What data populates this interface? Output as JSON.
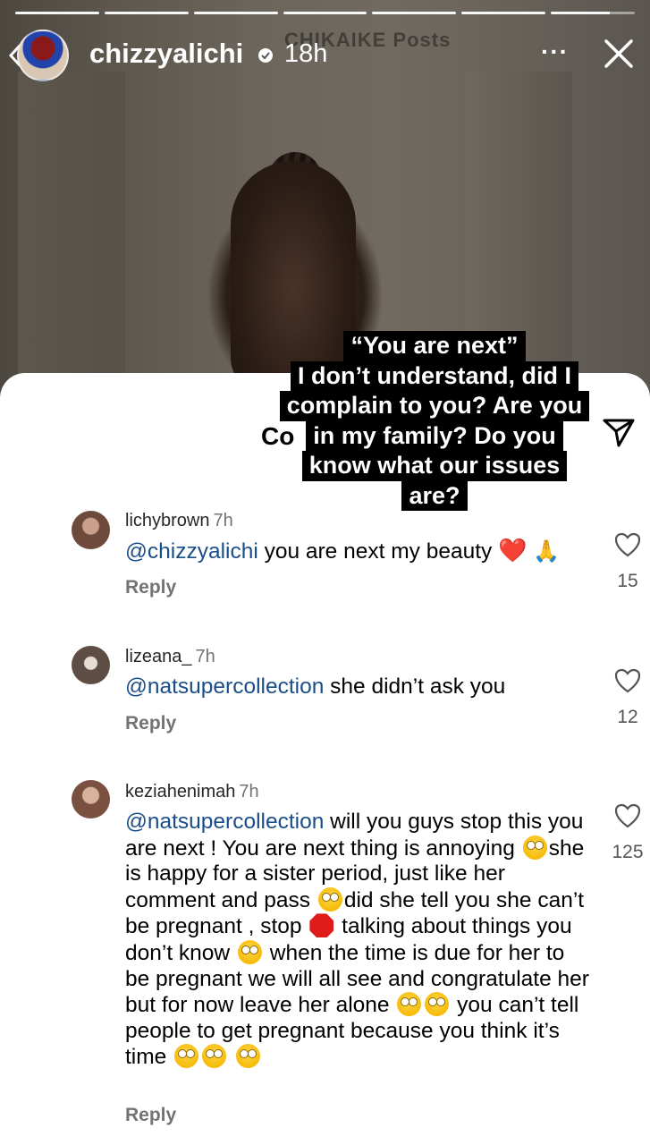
{
  "story": {
    "background_text": "CHIKAIKE Posts",
    "username": "chizzyalichi",
    "time": "18h",
    "more_label": "···",
    "progress_segments": 7,
    "progress_current_fraction": 0.7
  },
  "caption": {
    "lines": [
      "“You are next”",
      "I don’t understand, did I",
      "complain to you? Are you",
      "in my family? Do you",
      "know what our issues",
      "are?"
    ]
  },
  "sheet": {
    "title_partial": "Co"
  },
  "comments": [
    {
      "username": "lichybrown",
      "ago": "7h",
      "mention": "@chizzyalichi",
      "text": " you are next my beauty ",
      "emoji": [
        "❤️",
        "🙏"
      ],
      "reply_label": "Reply",
      "likes": "15"
    },
    {
      "username": "lizeana_",
      "ago": "7h",
      "mention": "@natsupercollection",
      "text": " she didn’t ask you",
      "reply_label": "Reply",
      "likes": "12"
    },
    {
      "username": "keziahenimah",
      "ago": "7h",
      "mention": "@natsupercollection",
      "text_parts": [
        " will you guys stop this you are next ! You are next thing is annoying ",
        "she is happy for a sister period, just like her comment and pass ",
        "did she tell you she can’t be pregnant , stop ",
        " talking about things you don’t know ",
        " when the time is due for her to be pregnant we will all see and congratulate her but for now leave her alone ",
        " you can’t tell people to get pregnant because you think it’s time "
      ],
      "reply_label": "Reply",
      "likes": "125"
    }
  ],
  "colors": {
    "mention": "#1a4e8a",
    "caption_bg": "#000000",
    "sheet_bg": "#ffffff"
  }
}
